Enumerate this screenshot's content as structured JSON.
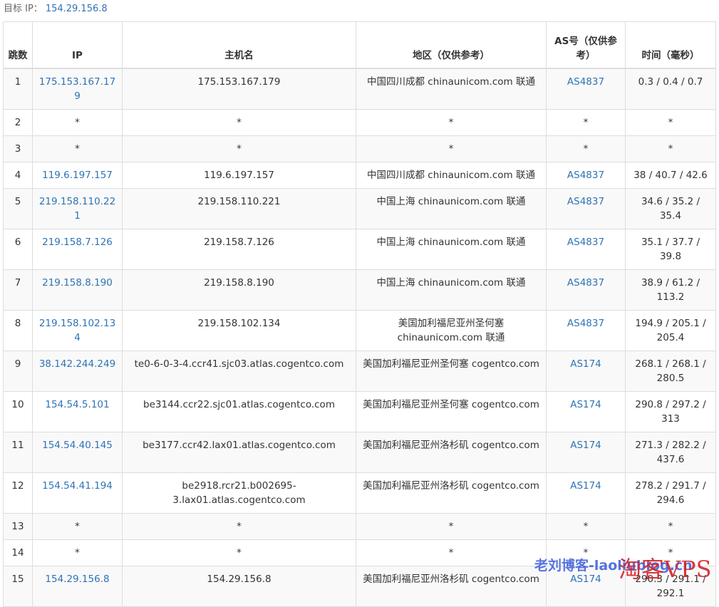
{
  "target": {
    "label": "目标 IP：",
    "ip": "154.29.156.8"
  },
  "headers": {
    "hop": "跳数",
    "ip": "IP",
    "hostname": "主机名",
    "region": "地区（仅供参考）",
    "as": "AS号（仅供参考）",
    "time": "时间（毫秒）"
  },
  "rows": [
    {
      "hop": "1",
      "ip": "175.153.167.179",
      "host": "175.153.167.179",
      "region": "中国四川成都 chinaunicom.com 联通",
      "as": "AS4837",
      "time": "0.3 / 0.4 / 0.7"
    },
    {
      "hop": "2",
      "ip": "*",
      "host": "*",
      "region": "*",
      "as": "*",
      "time": "*"
    },
    {
      "hop": "3",
      "ip": "*",
      "host": "*",
      "region": "*",
      "as": "*",
      "time": "*"
    },
    {
      "hop": "4",
      "ip": "119.6.197.157",
      "host": "119.6.197.157",
      "region": "中国四川成都 chinaunicom.com 联通",
      "as": "AS4837",
      "time": "38 / 40.7 / 42.6"
    },
    {
      "hop": "5",
      "ip": "219.158.110.221",
      "host": "219.158.110.221",
      "region": "中国上海 chinaunicom.com 联通",
      "as": "AS4837",
      "time": "34.6 / 35.2 / 35.4"
    },
    {
      "hop": "6",
      "ip": "219.158.7.126",
      "host": "219.158.7.126",
      "region": "中国上海 chinaunicom.com 联通",
      "as": "AS4837",
      "time": "35.1 / 37.7 / 39.8"
    },
    {
      "hop": "7",
      "ip": "219.158.8.190",
      "host": "219.158.8.190",
      "region": "中国上海 chinaunicom.com 联通",
      "as": "AS4837",
      "time": "38.9 / 61.2 / 113.2"
    },
    {
      "hop": "8",
      "ip": "219.158.102.134",
      "host": "219.158.102.134",
      "region": "美国加利福尼亚州圣何塞 chinaunicom.com 联通",
      "as": "AS4837",
      "time": "194.9 / 205.1 / 205.4"
    },
    {
      "hop": "9",
      "ip": "38.142.244.249",
      "host": "te0-6-0-3-4.ccr41.sjc03.atlas.cogentco.com",
      "region": "美国加利福尼亚州圣何塞 cogentco.com",
      "as": "AS174",
      "time": "268.1 / 268.1 / 280.5"
    },
    {
      "hop": "10",
      "ip": "154.54.5.101",
      "host": "be3144.ccr22.sjc01.atlas.cogentco.com",
      "region": "美国加利福尼亚州圣何塞 cogentco.com",
      "as": "AS174",
      "time": "290.8 / 297.2 / 313"
    },
    {
      "hop": "11",
      "ip": "154.54.40.145",
      "host": "be3177.ccr42.lax01.atlas.cogentco.com",
      "region": "美国加利福尼亚州洛杉矶 cogentco.com",
      "as": "AS174",
      "time": "271.3 / 282.2 / 437.6"
    },
    {
      "hop": "12",
      "ip": "154.54.41.194",
      "host": "be2918.rcr21.b002695-3.lax01.atlas.cogentco.com",
      "region": "美国加利福尼亚州洛杉矶 cogentco.com",
      "as": "AS174",
      "time": "278.2 / 291.7 / 294.6"
    },
    {
      "hop": "13",
      "ip": "*",
      "host": "*",
      "region": "*",
      "as": "*",
      "time": "*"
    },
    {
      "hop": "14",
      "ip": "*",
      "host": "*",
      "region": "*",
      "as": "*",
      "time": "*"
    },
    {
      "hop": "15",
      "ip": "154.29.156.8",
      "host": "154.29.156.8",
      "region": "美国加利福尼亚州洛杉矶 cogentco.com",
      "as": "AS174",
      "time": "290.3 / 291.1 / 292.1"
    }
  ],
  "watermarks": {
    "blog": "老刘博客-laoliublog.cn",
    "brand": "淘客VPS"
  },
  "colors": {
    "link": "#2f73b5",
    "stripe": "#f9f9f9",
    "border": "#dddddd",
    "watermark_blue": "#3a5bd9",
    "watermark_red": "#d4232a"
  }
}
